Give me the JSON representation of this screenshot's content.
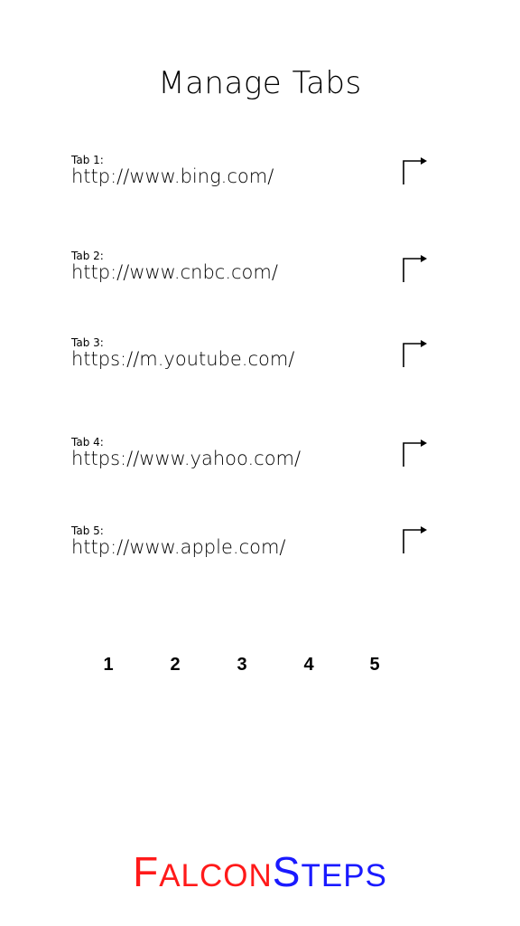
{
  "header": {
    "title": "Manage Tabs"
  },
  "tabs": [
    {
      "label": "Tab 1:",
      "url": "http://www.bing.com/",
      "action_icon": "open-tab-arrow-icon"
    },
    {
      "label": "Tab 2:",
      "url": "http://www.cnbc.com/",
      "action_icon": "open-tab-arrow-icon"
    },
    {
      "label": "Tab 3:",
      "url": "https://m.youtube.com/",
      "action_icon": "open-tab-arrow-icon"
    },
    {
      "label": "Tab 4:",
      "url": "https://www.yahoo.com/",
      "action_icon": "open-tab-arrow-icon"
    },
    {
      "label": "Tab 5:",
      "url": "http://www.apple.com/",
      "action_icon": "open-tab-arrow-icon"
    }
  ],
  "pager": {
    "pages": [
      "1",
      "2",
      "3",
      "4",
      "5"
    ]
  },
  "brand": {
    "part1_initial": "F",
    "part1_rest": "ALCON",
    "part2_initial": "S",
    "part2_rest": "TEPS",
    "part1_color": "#ff1a1a",
    "part2_color": "#1a1aff"
  }
}
